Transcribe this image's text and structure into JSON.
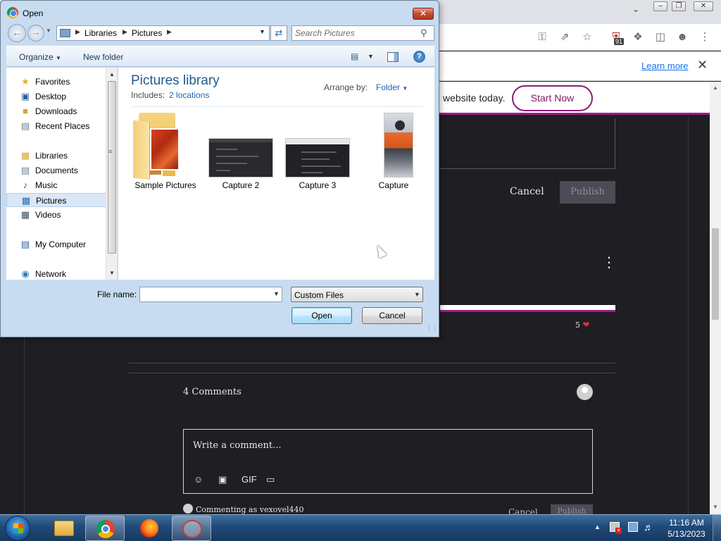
{
  "dialog": {
    "title": "Open",
    "address": {
      "crumbs": [
        "Libraries",
        "Pictures"
      ]
    },
    "search": {
      "placeholder": "Search Pictures"
    },
    "commands": {
      "organize": "Organize",
      "new_folder": "New folder"
    },
    "nav_pane": {
      "favorites_label": "Favorites",
      "favorites": [
        "Desktop",
        "Downloads",
        "Recent Places"
      ],
      "libraries_label": "Libraries",
      "libraries": [
        "Documents",
        "Music",
        "Pictures",
        "Videos"
      ],
      "selected": "Pictures",
      "computer": "My Computer",
      "network": "Network"
    },
    "library": {
      "title": "Pictures library",
      "includes_label": "Includes:",
      "includes_link": "2 locations",
      "arrange_label": "Arrange by:",
      "arrange_value": "Folder"
    },
    "files": [
      {
        "name": "Sample Pictures",
        "kind": "folder"
      },
      {
        "name": "Capture 2",
        "kind": "image"
      },
      {
        "name": "Capture 3",
        "kind": "image"
      },
      {
        "name": "Capture",
        "kind": "image"
      }
    ],
    "filename": {
      "label": "File name:",
      "value": ""
    },
    "filetype": {
      "value": "Custom Files"
    },
    "buttons": {
      "open": "Open",
      "cancel": "Cancel"
    }
  },
  "browser": {
    "infobar": {
      "learn_more": "Learn more"
    },
    "extension_badge": "91",
    "promo": {
      "text": "website today.",
      "button": "Start Now"
    },
    "post": {
      "cancel": "Cancel",
      "publish": "Publish",
      "likes": "5"
    },
    "comments": {
      "count_label": "4 Comments",
      "placeholder": "Write a comment...",
      "tools": [
        "emoji-icon",
        "camera-icon",
        "GIF",
        "video-icon"
      ],
      "commenting_as": "Commenting as vexovel440",
      "cancel": "Cancel",
      "publish": "Publish"
    }
  },
  "taskbar": {
    "clock_time": "11:16 AM",
    "clock_date": "5/13/2023"
  },
  "colors": {
    "dialog_frame": "#c7dcf0",
    "page_background": "#1f1e22",
    "accent_purple": "#9b1d86",
    "library_title": "#1e5a8c",
    "link_blue": "#1e64b4"
  }
}
